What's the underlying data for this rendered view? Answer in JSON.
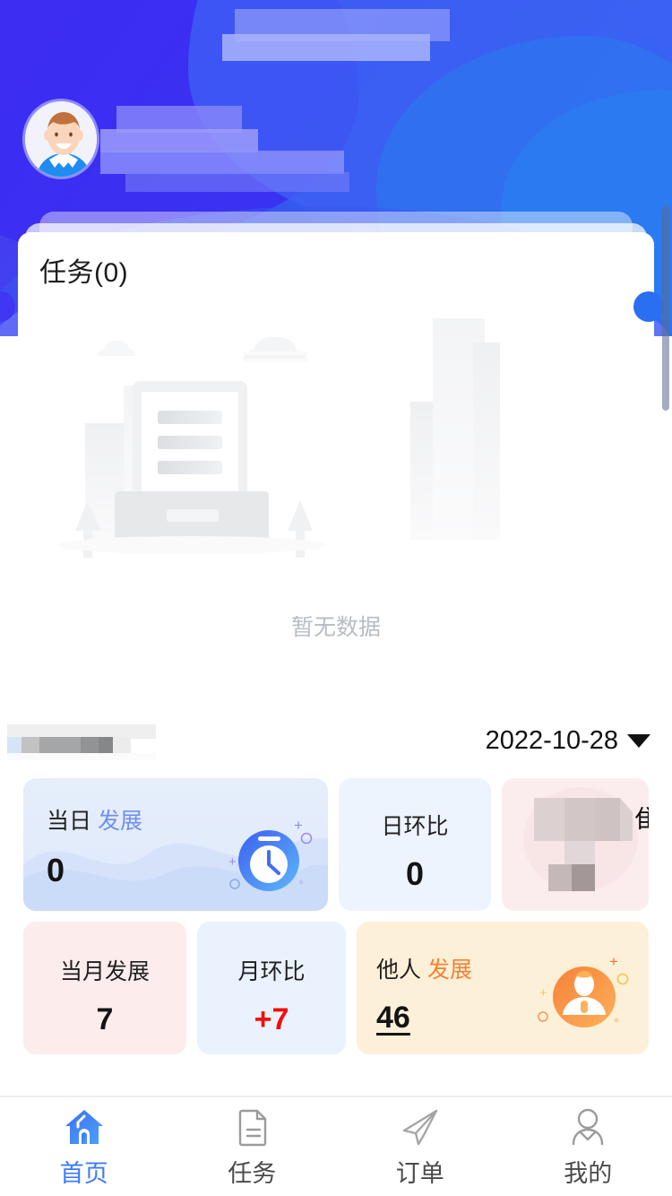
{
  "header": {
    "avatar_icon": "user-avatar-illustration",
    "censored_title": "[censored]",
    "censored_subtitle": "[censored]"
  },
  "task_card": {
    "title": "任务(0)",
    "empty_text": "暂无数据",
    "empty_illustration": "no-data-document-illustration"
  },
  "stats": {
    "section_title_censored": "[censored]",
    "date": "2022-10-28",
    "caret_icon": "chevron-down-icon",
    "cards": [
      {
        "id": "today-development",
        "label_dark": "当日",
        "label_accent": "发展",
        "value": "0",
        "icon": "stopwatch-icon",
        "bg": "#e3ecfb",
        "accent": "#6f8ff2"
      },
      {
        "id": "daily-change",
        "label_dark": "日环比",
        "label_accent": "",
        "value": "0",
        "icon": "",
        "bg": "#eef4fd",
        "accent": "#1f1f1f"
      },
      {
        "id": "censored-card",
        "label_dark": "",
        "label_accent": "隹",
        "value": "",
        "icon": "",
        "bg": "#fbedee",
        "accent": "#1f1f1f"
      },
      {
        "id": "month-development",
        "label_dark": "当月发展",
        "label_accent": "",
        "value": "7",
        "icon": "",
        "bg": "#fcecec",
        "accent": "#1f1f1f"
      },
      {
        "id": "month-over-month",
        "label_dark": "月环比",
        "label_accent": "",
        "value": "+7",
        "icon": "",
        "bg": "#eaf2fd",
        "accent": "#f40d0d"
      },
      {
        "id": "others-development",
        "label_dark": "他人",
        "label_accent": "发展",
        "value": "46",
        "icon": "person-badge-icon",
        "bg": "#fdf0d8",
        "accent": "#f68132"
      }
    ]
  },
  "tabbar": {
    "items": [
      {
        "label": "首页",
        "icon": "home-icon",
        "active": true
      },
      {
        "label": "任务",
        "icon": "document-icon",
        "active": false
      },
      {
        "label": "订单",
        "icon": "paper-plane-icon",
        "active": false
      },
      {
        "label": "我的",
        "icon": "person-icon",
        "active": false
      }
    ]
  },
  "colors": {
    "header_gradient_start": "#4e2df0",
    "header_gradient_end": "#2276ee",
    "active_tab": "#3e7bf6",
    "accent_blue": "#6f8ff2",
    "accent_orange": "#f68132",
    "accent_red": "#f40d0d"
  }
}
